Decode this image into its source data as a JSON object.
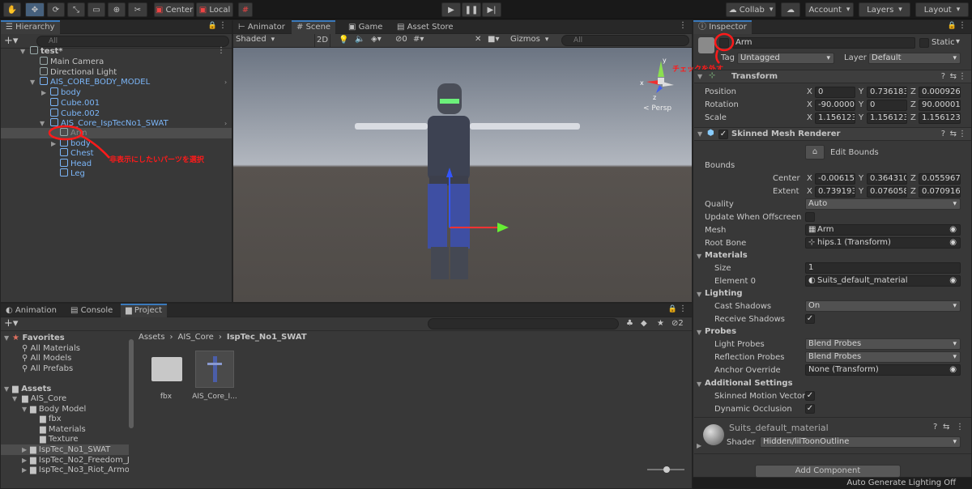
{
  "toolbar": {
    "tools": [
      "hand-icon",
      "move-icon",
      "rotate-icon",
      "scale-icon",
      "rect-icon",
      "transform-icon",
      "custom-tool-icon"
    ],
    "pivot_label": "Center",
    "space_label": "Local",
    "collab_label": "Collab",
    "account_label": "Account",
    "layers_label": "Layers",
    "layout_label": "Layout"
  },
  "hierarchy": {
    "tab": "Hierarchy",
    "search_placeholder": "All",
    "items": [
      {
        "label": "test*"
      },
      {
        "label": "Main Camera"
      },
      {
        "label": "Directional Light"
      },
      {
        "label": "AIS_CORE_BODY_MODEL"
      },
      {
        "label": "body"
      },
      {
        "label": "Cube.001"
      },
      {
        "label": "Cube.002"
      },
      {
        "label": "AIS_Core_IspTecNo1_SWAT"
      },
      {
        "label": "Arm"
      },
      {
        "label": "body"
      },
      {
        "label": "Chest"
      },
      {
        "label": "Head"
      },
      {
        "label": "Leg"
      }
    ],
    "annotation": "非表示にしたいパーツを選択"
  },
  "scene": {
    "tabs": [
      "Animator",
      "Scene",
      "Game",
      "Asset Store"
    ],
    "shading": "Shaded",
    "mode_2d": "2D",
    "hidden_count": "0",
    "gizmos": "Gizmos",
    "search_placeholder": "All",
    "persp_label": "< Persp",
    "gizmo_axes": {
      "x": "x",
      "y": "y",
      "z": "z"
    }
  },
  "bottom": {
    "tabs": [
      "Animation",
      "Console",
      "Project"
    ],
    "favorites_label": "Favorites",
    "favorites": [
      "All Materials",
      "All Models",
      "All Prefabs"
    ],
    "assets_label": "Assets",
    "tree": [
      "AIS_Core",
      "Body Model",
      "fbx",
      "Materials",
      "Texture",
      "IspTec_No1_SWAT",
      "IspTec_No2_Freedom_J",
      "IspTec_No3_Riot_Armor"
    ],
    "breadcrumb": [
      "Assets",
      "AIS_Core",
      "IspTec_No1_SWAT"
    ],
    "files": [
      {
        "label": "fbx"
      },
      {
        "label": "AIS_Core_I..."
      }
    ],
    "count_badge": "2"
  },
  "inspector": {
    "tab": "Inspector",
    "object_name": "Arm",
    "static_label": "Static",
    "tag_label": "Tag",
    "tag_value": "Untagged",
    "layer_label": "Layer",
    "layer_value": "Default",
    "annotation": "チェックを外す",
    "transform": {
      "title": "Transform",
      "position_label": "Position",
      "rotation_label": "Rotation",
      "scale_label": "Scale",
      "position": [
        "0",
        "0.7361834",
        "0.0009268"
      ],
      "rotation": [
        "-90.00001",
        "0",
        "90.00001"
      ],
      "scale": [
        "1.156123",
        "1.156123",
        "1.156123"
      ]
    },
    "smr": {
      "title": "Skinned Mesh Renderer",
      "edit_bounds": "Edit Bounds",
      "bounds_label": "Bounds",
      "center_label": "Center",
      "extent_label": "Extent",
      "center": [
        "-0.006156",
        "0.364310",
        "0.055967"
      ],
      "extent": [
        "0.739193",
        "0.076058",
        "0.070916"
      ],
      "quality_label": "Quality",
      "quality_value": "Auto",
      "update_offscreen_label": "Update When Offscreen",
      "mesh_label": "Mesh",
      "mesh_value": "Arm",
      "root_bone_label": "Root Bone",
      "root_bone_value": "hips.1 (Transform)",
      "materials_label": "Materials",
      "size_label": "Size",
      "size_value": "1",
      "element0_label": "Element 0",
      "element0_value": "Suits_default_material",
      "lighting_label": "Lighting",
      "cast_shadows_label": "Cast Shadows",
      "cast_shadows_value": "On",
      "receive_shadows_label": "Receive Shadows",
      "probes_label": "Probes",
      "light_probes_label": "Light Probes",
      "light_probes_value": "Blend Probes",
      "reflection_probes_label": "Reflection Probes",
      "reflection_probes_value": "Blend Probes",
      "anchor_override_label": "Anchor Override",
      "anchor_override_value": "None (Transform)",
      "additional_label": "Additional Settings",
      "skinned_motion_label": "Skinned Motion Vectors",
      "dynamic_occlusion_label": "Dynamic Occlusion"
    },
    "material": {
      "name": "Suits_default_material",
      "shader_label": "Shader",
      "shader_value": "Hidden/lilToonOutline"
    },
    "add_component": "Add Component"
  },
  "status_bar": "Auto Generate Lighting Off",
  "colors": {
    "accent": "#3a79bb",
    "annotation": "#ff1a1a",
    "prefab_blue": "#7bb5f7"
  }
}
